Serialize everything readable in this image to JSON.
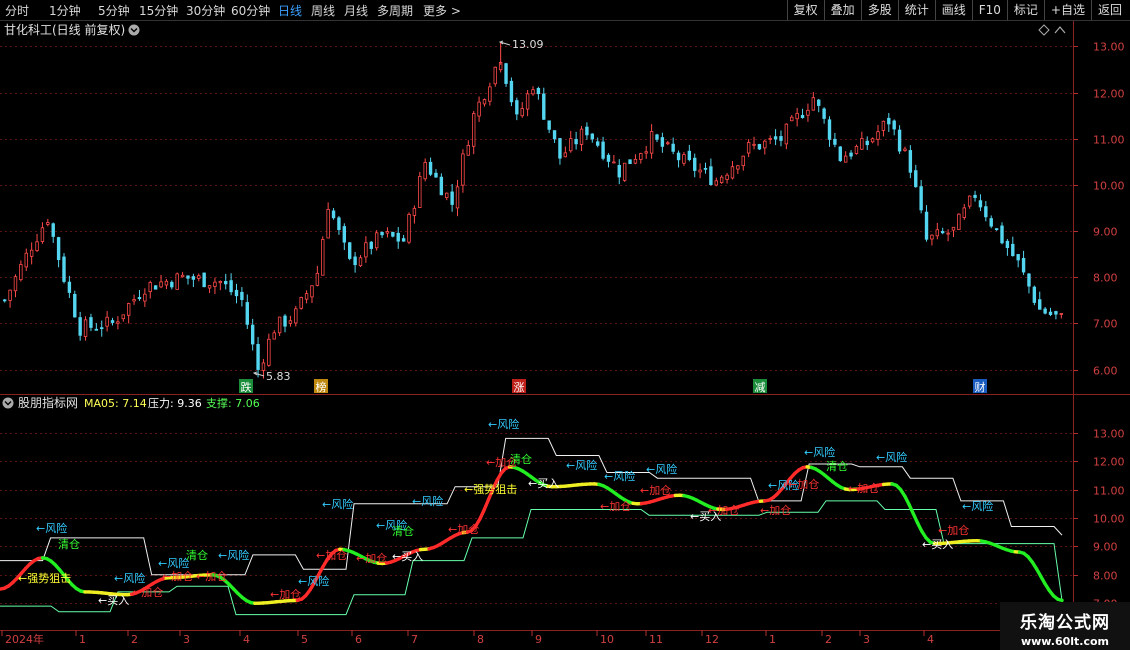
{
  "toolbar": {
    "periods": [
      "分时",
      "1分钟",
      "5分钟",
      "15分钟",
      "30分钟",
      "60分钟",
      "日线",
      "周线",
      "月线",
      "多周期",
      "更多 >"
    ],
    "active_period": "日线",
    "tools": [
      "复权",
      "叠加",
      "多股",
      "统计",
      "画线",
      "F10",
      "标记",
      "+自选",
      "返回"
    ]
  },
  "main_chart": {
    "title": "甘化科工(日线 前复权)",
    "high_label": "13.09",
    "low_label": "5.83",
    "events": [
      {
        "label": "跌",
        "color": "#1a8c3a"
      },
      {
        "label": "榜",
        "color": "#c08a10"
      },
      {
        "label": "涨",
        "color": "#c0201a"
      },
      {
        "label": "减",
        "color": "#1a8c3a"
      },
      {
        "label": "财",
        "color": "#1a5cc0"
      }
    ]
  },
  "indicator": {
    "name": "股朋指标网",
    "ma_label": "MA05: 7.14",
    "pressure_label": "压力: 9.36",
    "support_label": "支撑: 7.06",
    "signals": [
      {
        "text": "←风险",
        "color": "#33ccff"
      },
      {
        "text": "清仓",
        "color": "#33ff33"
      },
      {
        "text": "←强势狙击",
        "color": "#ffff33"
      },
      {
        "text": "←买入",
        "color": "#ffffff"
      },
      {
        "text": "←加仓",
        "color": "#ff3333"
      }
    ]
  },
  "chart_data": [
    {
      "type": "candlestick",
      "title": "甘化科工(日线 前复权)",
      "ylim": [
        5.6,
        13.4
      ],
      "y_ticks": [
        "13.00",
        "12.00",
        "11.00",
        "10.00",
        "9.00",
        "8.00",
        "7.00",
        "6.00"
      ],
      "close_path": [
        {
          "t": 0,
          "c": 7.5
        },
        {
          "t": 5,
          "c": 8.7
        },
        {
          "t": 8,
          "c": 9.3
        },
        {
          "t": 11,
          "c": 8.0
        },
        {
          "t": 14,
          "c": 6.9
        },
        {
          "t": 20,
          "c": 7.0
        },
        {
          "t": 26,
          "c": 7.8
        },
        {
          "t": 33,
          "c": 8.0
        },
        {
          "t": 40,
          "c": 7.9
        },
        {
          "t": 44,
          "c": 7.5
        },
        {
          "t": 47,
          "c": 6.0
        },
        {
          "t": 50,
          "c": 6.9
        },
        {
          "t": 54,
          "c": 7.2
        },
        {
          "t": 58,
          "c": 8.1
        },
        {
          "t": 60,
          "c": 9.6
        },
        {
          "t": 64,
          "c": 8.3
        },
        {
          "t": 70,
          "c": 8.9
        },
        {
          "t": 74,
          "c": 8.8
        },
        {
          "t": 78,
          "c": 10.5
        },
        {
          "t": 83,
          "c": 9.6
        },
        {
          "t": 87,
          "c": 11.5
        },
        {
          "t": 92,
          "c": 12.8
        },
        {
          "t": 95,
          "c": 11.4
        },
        {
          "t": 98,
          "c": 12.2
        },
        {
          "t": 103,
          "c": 10.6
        },
        {
          "t": 108,
          "c": 11.2
        },
        {
          "t": 114,
          "c": 10.3
        },
        {
          "t": 120,
          "c": 11.0
        },
        {
          "t": 126,
          "c": 10.5
        },
        {
          "t": 132,
          "c": 10.1
        },
        {
          "t": 138,
          "c": 10.8
        },
        {
          "t": 144,
          "c": 11.0
        },
        {
          "t": 150,
          "c": 11.9
        },
        {
          "t": 155,
          "c": 10.6
        },
        {
          "t": 160,
          "c": 10.9
        },
        {
          "t": 164,
          "c": 11.4
        },
        {
          "t": 168,
          "c": 10.4
        },
        {
          "t": 171,
          "c": 8.8
        },
        {
          "t": 176,
          "c": 9.0
        },
        {
          "t": 180,
          "c": 9.8
        },
        {
          "t": 184,
          "c": 9.0
        },
        {
          "t": 188,
          "c": 8.3
        },
        {
          "t": 192,
          "c": 7.3
        },
        {
          "t": 196,
          "c": 7.1
        }
      ],
      "high": 13.09,
      "low": 5.83
    },
    {
      "type": "line",
      "title": "股朋指标网",
      "ylim": [
        6.2,
        13.8
      ],
      "y_ticks": [
        "13.00",
        "12.00",
        "11.00",
        "10.00",
        "9.00",
        "8.00",
        "7.00"
      ],
      "x_ticks": [
        "2024年",
        "1",
        "2",
        "3",
        "4",
        "5",
        "6",
        "7",
        "8",
        "9",
        "10",
        "11",
        "12",
        "1",
        "2",
        "3",
        "4"
      ],
      "series": [
        {
          "name": "MA05",
          "values": [
            7.5,
            8.6,
            7.4,
            7.3,
            7.9,
            8.0,
            7.0,
            7.1,
            8.9,
            8.4,
            8.9,
            9.5,
            11.8,
            11.1,
            11.2,
            10.5,
            10.8,
            10.3,
            10.6,
            11.8,
            11.0,
            11.2,
            9.1,
            9.2,
            8.8,
            7.1
          ]
        },
        {
          "name": "压力",
          "values": [
            8.5,
            9.3,
            9.3,
            8.0,
            8.0,
            8.7,
            8.2,
            10.5,
            10.5,
            11.1,
            12.8,
            12.2,
            11.6,
            11.4,
            11.4,
            10.6,
            11.9,
            11.8,
            11.4,
            10.6,
            9.7,
            9.4
          ]
        },
        {
          "name": "支撑",
          "values": [
            6.9,
            6.7,
            7.4,
            7.6,
            6.6,
            6.6,
            7.3,
            8.5,
            9.3,
            10.3,
            10.3,
            10.1,
            10.1,
            10.2,
            10.6,
            10.3,
            9.1,
            9.1,
            7.1
          ]
        }
      ]
    }
  ]
}
